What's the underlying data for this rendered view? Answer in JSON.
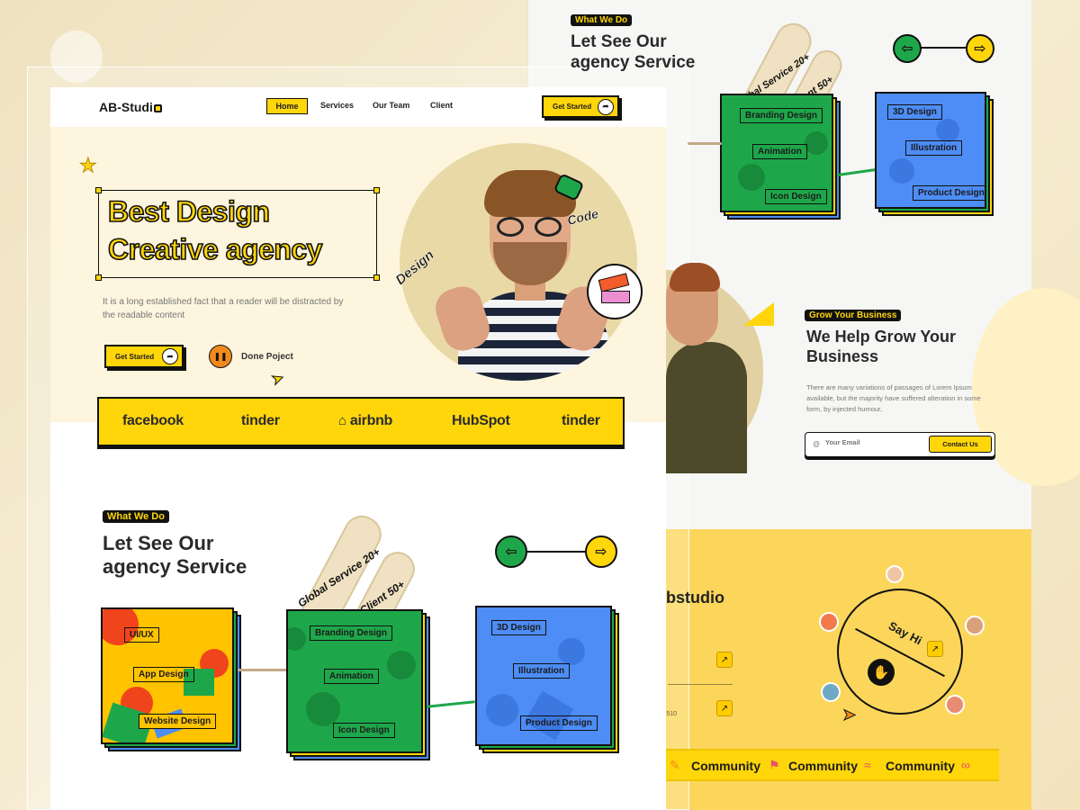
{
  "colors": {
    "accent": "#ffd60a",
    "green": "#1ea74a",
    "blue": "#4d8df5",
    "dark": "#111111",
    "cream": "#fdf5de"
  },
  "back_services": {
    "tag": "What We Do",
    "title_line1": "Let See Our",
    "title_line2": "agency Service",
    "pill1": "Global Service 20+",
    "pill2": "Client 50+",
    "prev_icon": "arrow-left-icon",
    "next_icon": "arrow-right-icon",
    "green_card": [
      "Branding Design",
      "Animation",
      "Icon Design"
    ],
    "blue_card": [
      "3D Design",
      "Illustration",
      "Product Design"
    ]
  },
  "back_business": {
    "tag": "Grow Your Business",
    "title_line1": "We Help Grow Your",
    "title_line2": "Business",
    "desc": "There are many variations of passages of Lorem Ipsum available, but the majority have suffered alteration in some form, by injected humour,",
    "email_placeholder": "Your Email",
    "contact_label": "Contact Us"
  },
  "back_footer": {
    "brand_partial": "bstudio",
    "say_hi": "Say Hi",
    "wave_icon": "waving-hand-icon",
    "phone_partial": "-510",
    "community": [
      "Community",
      "Community",
      "Community"
    ]
  },
  "nav": {
    "logo": "AB-Studi",
    "items": [
      "Home",
      "Services",
      "Our Team",
      "Client"
    ],
    "cta": "Get Started"
  },
  "hero": {
    "line1": "Best Design",
    "line2": "Creative agency",
    "desc": "It is a long established fact that a reader will be distracted by the readable content",
    "cta": "Get Started",
    "secondary": "Done Poject",
    "sticker_design": "Design",
    "sticker_code": "Code"
  },
  "brands": [
    "facebook",
    "tinder",
    "airbnb",
    "HubSpot",
    "tinder"
  ],
  "services": {
    "tag": "What We Do",
    "title_line1": "Let See Our",
    "title_line2": "agency Service",
    "pill1": "Global Service 20+",
    "pill2": "Client 50+",
    "yellow_card": [
      "UI/UX",
      "App Design",
      "Website Design"
    ],
    "green_card": [
      "Branding Design",
      "Animation",
      "Icon Design"
    ],
    "blue_card": [
      "3D Design",
      "Illustration",
      "Product Design"
    ]
  }
}
